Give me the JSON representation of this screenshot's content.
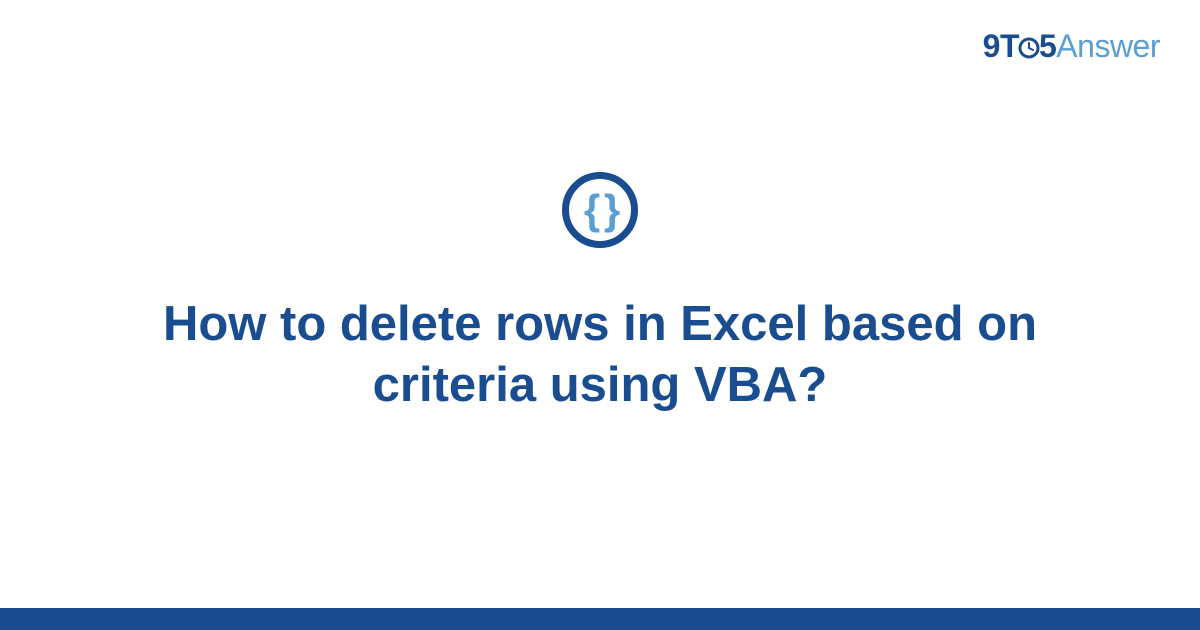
{
  "logo": {
    "part1": "9T",
    "o_char": "O",
    "part1b": "5",
    "part2": "Answer"
  },
  "icon": {
    "symbol": "{ }",
    "semantic": "code-braces-icon"
  },
  "title": "How to delete rows in Excel based on criteria using VBA?",
  "colors": {
    "primary": "#1a4d8f",
    "accent": "#5a9fd4",
    "background": "#ffffff"
  }
}
